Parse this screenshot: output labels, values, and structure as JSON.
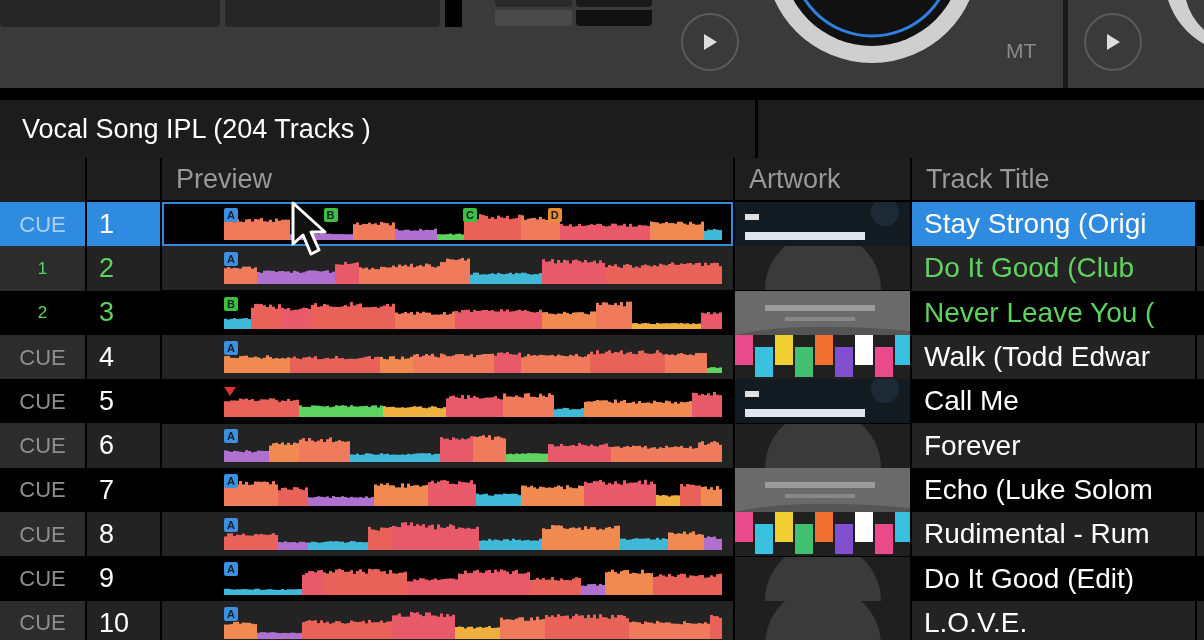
{
  "deck": {
    "mode_label": "MT"
  },
  "playlist": {
    "title": "Vocal Song IPL (204 Tracks )"
  },
  "columns": [
    "Preview",
    "Artwork",
    "Track Title"
  ],
  "tracks": [
    {
      "cue": "CUE",
      "number": "1",
      "title": "Stay Strong (Origi",
      "selected": true,
      "loaded": false,
      "markers": [
        {
          "kind": "letter",
          "label": "A",
          "color": "#3d8fe0"
        },
        {
          "kind": "letter",
          "label": "B",
          "color": "#3fbf3f"
        },
        {
          "kind": "letter",
          "label": "C",
          "color": "#3fbf3f"
        },
        {
          "kind": "letter",
          "label": "D",
          "color": "#f08a30"
        }
      ]
    },
    {
      "cue": "1",
      "number": "2",
      "title": "Do It Good (Club",
      "selected": false,
      "loaded": true,
      "artwork": {
        "kind": "placeholder"
      },
      "markers": [
        {
          "kind": "letter",
          "label": "A",
          "color": "#3d8fe0"
        }
      ]
    },
    {
      "cue": "2",
      "number": "3",
      "title": "Never Leave You (",
      "selected": false,
      "loaded": true,
      "markers": [
        {
          "kind": "letter",
          "label": "B",
          "color": "#3fbf3f"
        }
      ]
    },
    {
      "cue": "CUE",
      "number": "4",
      "title": "Walk (Todd Edwar",
      "selected": false,
      "loaded": false,
      "markers": [
        {
          "kind": "letter",
          "label": "A",
          "color": "#3d8fe0"
        }
      ]
    },
    {
      "cue": "CUE",
      "number": "5",
      "title": "Call Me",
      "selected": false,
      "loaded": false,
      "markers": [
        {
          "kind": "triangle",
          "color": "#e03030"
        }
      ]
    },
    {
      "cue": "CUE",
      "number": "6",
      "title": "Forever",
      "selected": false,
      "loaded": false,
      "artwork": {
        "kind": "placeholder"
      },
      "markers": [
        {
          "kind": "letter",
          "label": "A",
          "color": "#3d8fe0"
        }
      ]
    },
    {
      "cue": "CUE",
      "number": "7",
      "title": "Echo (Luke Solom",
      "selected": false,
      "loaded": false,
      "markers": [
        {
          "kind": "letter",
          "label": "A",
          "color": "#3d8fe0"
        }
      ]
    },
    {
      "cue": "CUE",
      "number": "8",
      "title": "Rudimental - Rum",
      "selected": false,
      "loaded": false,
      "markers": [
        {
          "kind": "letter",
          "label": "A",
          "color": "#3d8fe0"
        }
      ]
    },
    {
      "cue": "CUE",
      "number": "9",
      "title": "Do It Good (Edit)",
      "selected": false,
      "loaded": false,
      "artwork": {
        "kind": "placeholder"
      },
      "markers": [
        {
          "kind": "letter",
          "label": "A",
          "color": "#3d8fe0"
        }
      ]
    },
    {
      "cue": "CUE",
      "number": "10",
      "title": "L.O.V.E.",
      "selected": false,
      "loaded": false,
      "artwork": {
        "kind": "placeholder"
      },
      "markers": [
        {
          "kind": "letter",
          "label": "A",
          "color": "#3d8fe0"
        }
      ]
    }
  ]
}
